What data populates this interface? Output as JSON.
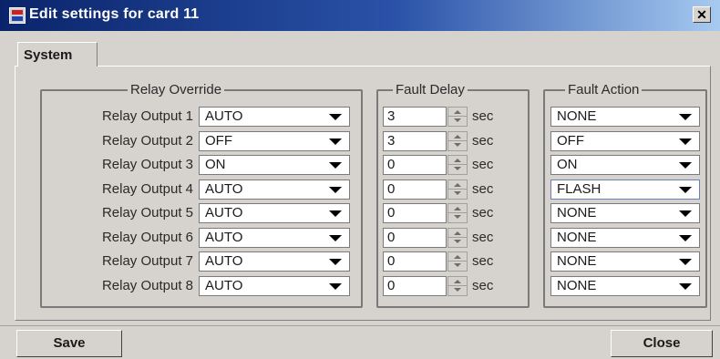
{
  "window": {
    "title": "Edit settings for card 11",
    "close_glyph": "✕"
  },
  "tabs": [
    {
      "label": "System"
    }
  ],
  "groups": {
    "relay_override": "Relay Override",
    "fault_delay": "Fault Delay",
    "fault_action": "Fault Action"
  },
  "unit_label": "sec",
  "rows": [
    {
      "label": "Relay Output 1",
      "override": "AUTO",
      "delay": "3",
      "action": "NONE"
    },
    {
      "label": "Relay Output 2",
      "override": "OFF",
      "delay": "3",
      "action": "OFF"
    },
    {
      "label": "Relay Output 3",
      "override": "ON",
      "delay": "0",
      "action": "ON"
    },
    {
      "label": "Relay Output 4",
      "override": "AUTO",
      "delay": "0",
      "action": "FLASH"
    },
    {
      "label": "Relay Output 5",
      "override": "AUTO",
      "delay": "0",
      "action": "NONE"
    },
    {
      "label": "Relay Output 6",
      "override": "AUTO",
      "delay": "0",
      "action": "NONE"
    },
    {
      "label": "Relay Output 7",
      "override": "AUTO",
      "delay": "0",
      "action": "NONE"
    },
    {
      "label": "Relay Output 8",
      "override": "AUTO",
      "delay": "0",
      "action": "NONE"
    }
  ],
  "buttons": {
    "save": "Save",
    "close": "Close"
  }
}
